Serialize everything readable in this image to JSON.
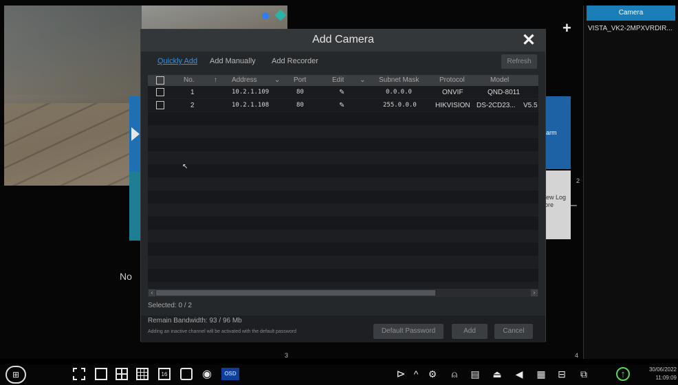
{
  "background": {
    "no_video_label": "No",
    "channel_numbers": [
      "3",
      "4",
      "2"
    ],
    "right_tile_blue_text": "larm",
    "right_tile_grey_text": "iew Log\nore"
  },
  "camera_list": {
    "header": "Camera",
    "items": [
      "VISTA_VK2-2MPXVRDIR..."
    ]
  },
  "dialog": {
    "title": "Add Camera",
    "tabs": [
      "Quickly Add",
      "Add Manually",
      "Add Recorder"
    ],
    "active_tab": "Quickly Add",
    "refresh_label": "Refresh",
    "columns": [
      "No.",
      "Address",
      "Port",
      "Edit",
      "Subnet Mask",
      "Protocol",
      "Model"
    ],
    "rows": [
      {
        "no": "1",
        "address": "10.2.1.109",
        "port": "80",
        "subnet": "0.0.0.0",
        "protocol": "ONVIF",
        "model": "QND-8011",
        "extra": ""
      },
      {
        "no": "2",
        "address": "10.2.1.108",
        "port": "80",
        "subnet": "255.0.0.0",
        "protocol": "HIKVISION",
        "model": "DS-2CD23...",
        "extra": "V5.5"
      }
    ],
    "selected_text": "Selected: 0 / 2",
    "bandwidth_text": "Remain Bandwidth: 93 / 96 Mb",
    "note_text": "Adding an inactive channel will be activated with the default password",
    "buttons": {
      "default_password": "Default Password",
      "add": "Add",
      "cancel": "Cancel"
    }
  },
  "taskbar": {
    "osd_label": "OSD",
    "grid_16_label": "16",
    "date": "30/06/2022",
    "time": "11:09:09"
  },
  "colors": {
    "accent_blue": "#1a7fb8",
    "tab_active": "#3c8fd8",
    "dialog_bg": "#25282b"
  }
}
